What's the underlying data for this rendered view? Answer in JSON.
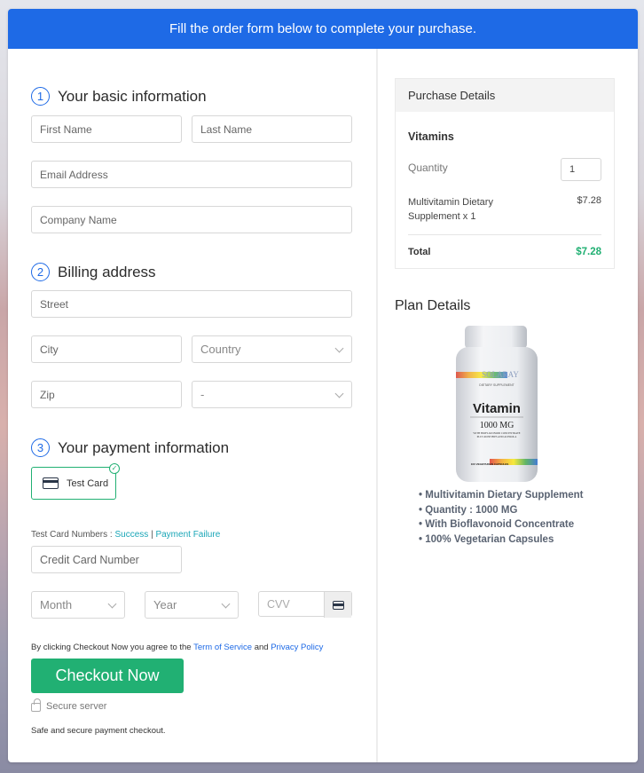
{
  "banner": {
    "text": "Fill the order form below to complete your purchase."
  },
  "form": {
    "sections": [
      {
        "number": "1",
        "title": "Your basic information"
      },
      {
        "number": "2",
        "title": "Billing address"
      },
      {
        "number": "3",
        "title": "Your payment information"
      }
    ],
    "basic": {
      "first_name": {
        "placeholder": "First Name",
        "value": ""
      },
      "last_name": {
        "placeholder": "Last Name",
        "value": ""
      },
      "email": {
        "placeholder": "Email Address",
        "value": ""
      },
      "company": {
        "placeholder": "Company Name",
        "value": ""
      }
    },
    "billing": {
      "street": {
        "placeholder": "Street",
        "value": ""
      },
      "city": {
        "placeholder": "City",
        "value": ""
      },
      "country": {
        "selected": "Country"
      },
      "zip": {
        "placeholder": "Zip",
        "value": ""
      },
      "state": {
        "selected": "-"
      }
    },
    "payment": {
      "method_label": "Test Card",
      "method_selected": true,
      "test_numbers_label": "Test Card Numbers :",
      "success_link": "Success",
      "separator": "|",
      "failure_link": "Payment Failure",
      "card_number": {
        "placeholder": "Credit Card Number",
        "value": ""
      },
      "month": {
        "selected": "Month"
      },
      "year": {
        "selected": "Year"
      },
      "cvv": {
        "placeholder": "CVV",
        "value": ""
      }
    },
    "terms": {
      "prefix": "By clicking Checkout Now you agree to the",
      "tos_link": "Term of Service",
      "and": "and",
      "privacy_link": "Privacy Policy"
    },
    "checkout_button": "Checkout Now",
    "secure_server": "Secure server",
    "safe_text": "Safe and secure payment checkout."
  },
  "purchase": {
    "title": "Purchase Details",
    "product": "Vitamins",
    "quantity_label": "Quantity",
    "quantity_value": "1",
    "line_item": "Multivitamin Dietary Supplement x 1",
    "line_price": "$7.28",
    "total_label": "Total",
    "total_value": "$7.28"
  },
  "plan": {
    "title": "Plan Details",
    "image": {
      "brand": "SOLARAY",
      "tagline": "DIETARY SUPPLEMENT",
      "name": "Vitamin",
      "strength": "1000 MG",
      "desc1": "WITH BIOFLAVONOID CONCENTRATE",
      "desc2": "PLUS ROSE HIPS AND ACEROLA",
      "count": "100 VEGETARIAN CAPSULES"
    },
    "features": [
      "Multivitamin Dietary Supplement",
      "Quantity : 1000 MG",
      "With Bioflavonoid Concentrate",
      "100% Vegetarian Capsules"
    ]
  },
  "colors": {
    "primary": "#1e6ae6",
    "success": "#21b073",
    "link": "#1aa6b7"
  }
}
